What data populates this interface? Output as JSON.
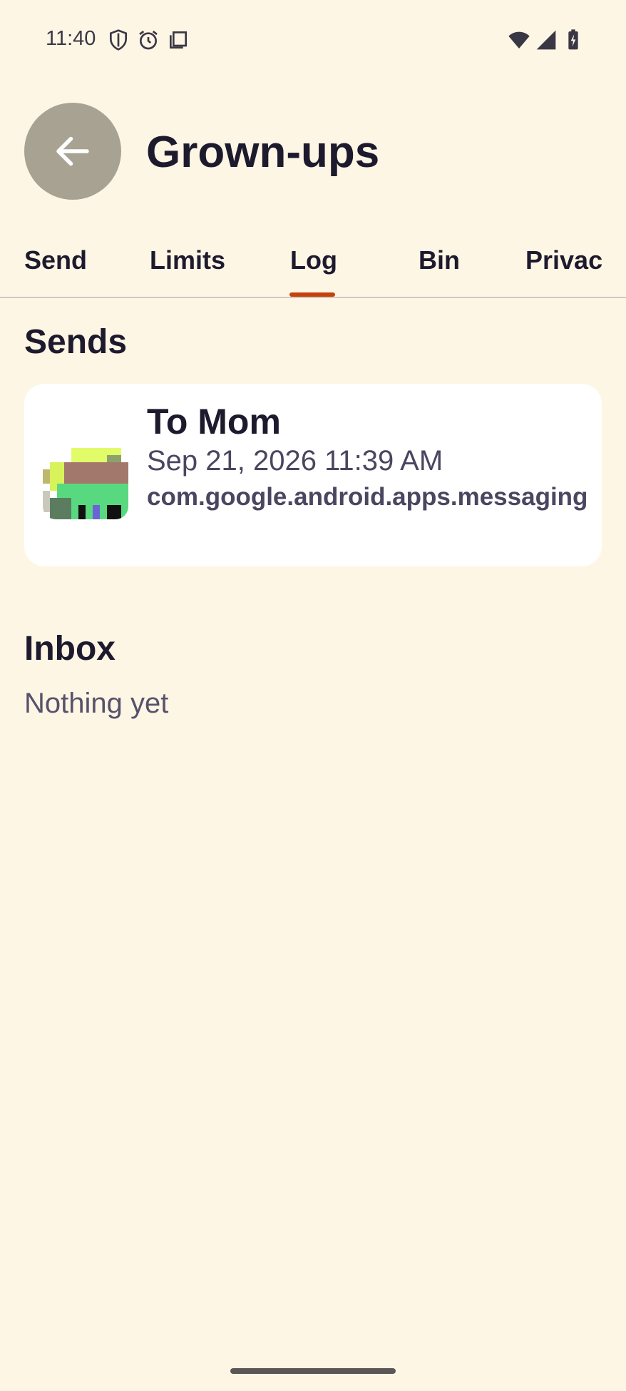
{
  "status_bar": {
    "time": "11:40",
    "left_icons": [
      "shield-icon",
      "alarm-icon",
      "screenshot-icon"
    ],
    "right_icons": [
      "wifi-icon",
      "signal-icon",
      "battery-charging-icon"
    ]
  },
  "header": {
    "back_icon": "arrow-left-icon",
    "title": "Grown-ups"
  },
  "tabs": [
    {
      "label": "Send",
      "selected": false
    },
    {
      "label": "Limits",
      "selected": false
    },
    {
      "label": "Log",
      "selected": true
    },
    {
      "label": "Bin",
      "selected": false
    },
    {
      "label": "Privac",
      "selected": false
    }
  ],
  "sends": {
    "title": "Sends",
    "items": [
      {
        "recipient": "To Mom",
        "time": "Sep 21, 2026 11:39 AM",
        "package": "com.google.android.apps.messaging"
      }
    ]
  },
  "inbox": {
    "title": "Inbox",
    "empty_text": "Nothing yet"
  },
  "colors": {
    "background": "#fef6e5",
    "accent": "#c7400c",
    "back_button": "#a7a292"
  }
}
